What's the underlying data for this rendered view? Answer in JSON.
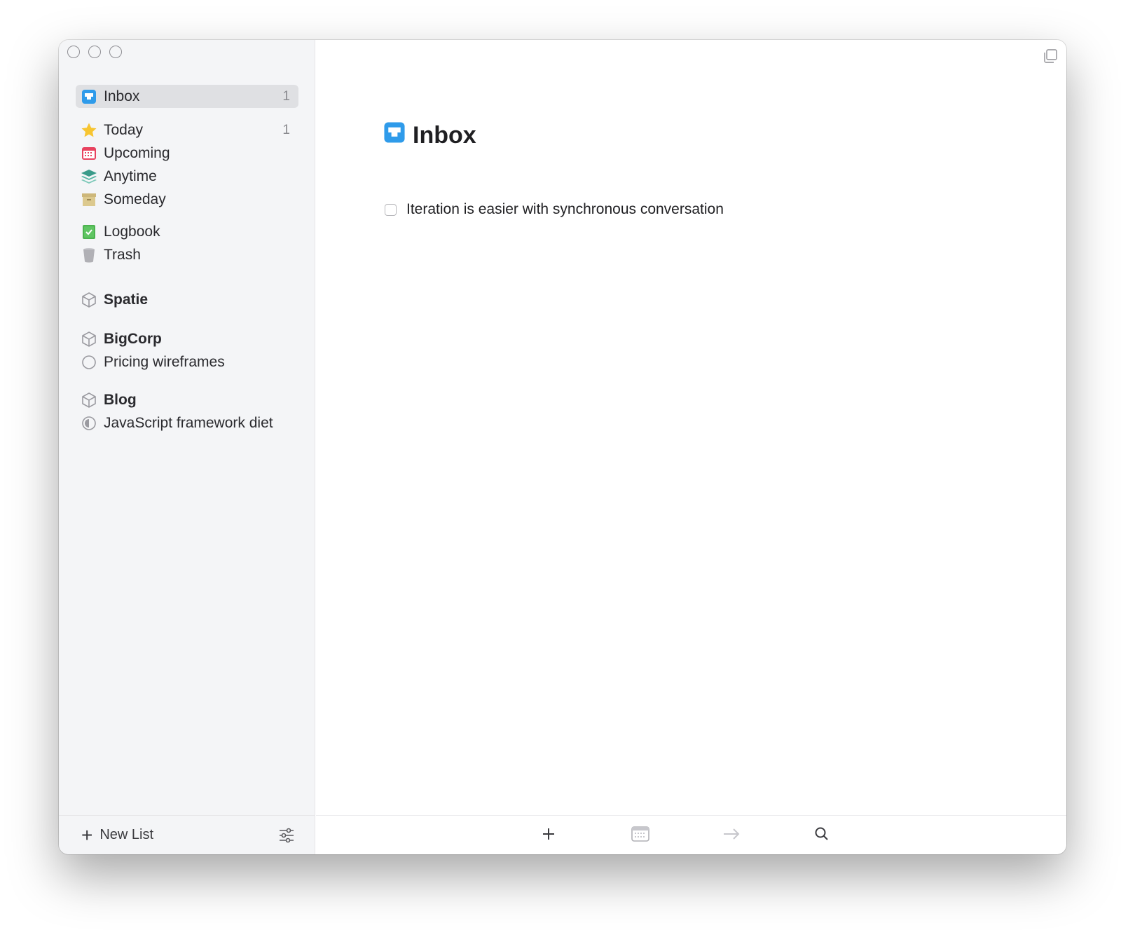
{
  "sidebar": {
    "items": [
      {
        "label": "Inbox",
        "count": "1",
        "icon": "inbox-icon"
      },
      {
        "label": "Today",
        "count": "1",
        "icon": "star-icon"
      },
      {
        "label": "Upcoming",
        "icon": "calendar-icon"
      },
      {
        "label": "Anytime",
        "icon": "layers-icon"
      },
      {
        "label": "Someday",
        "icon": "archive-box-icon"
      },
      {
        "label": "Logbook",
        "icon": "logbook-icon"
      },
      {
        "label": "Trash",
        "icon": "trash-icon"
      }
    ],
    "areas": [
      {
        "label": "Spatie",
        "icon": "area-cube-icon"
      },
      {
        "label": "BigCorp",
        "icon": "area-cube-icon",
        "projects": [
          {
            "label": "Pricing wireframes",
            "icon": "project-circle-icon"
          }
        ]
      },
      {
        "label": "Blog",
        "icon": "area-cube-icon",
        "projects": [
          {
            "label": "JavaScript framework diet",
            "icon": "project-progress-icon"
          }
        ]
      }
    ],
    "footer": {
      "new_list_label": "New List"
    }
  },
  "main": {
    "title": "Inbox",
    "tasks": [
      {
        "title": "Iteration is easier with synchronous conversation",
        "checked": false
      }
    ]
  },
  "colors": {
    "inbox_blue": "#2f9bea",
    "today_yellow": "#f7c531",
    "upcoming_red": "#e8425f",
    "anytime_teal": "#3a9b8a",
    "someday_tan": "#cdb77a",
    "logbook_green": "#4cb34f"
  }
}
